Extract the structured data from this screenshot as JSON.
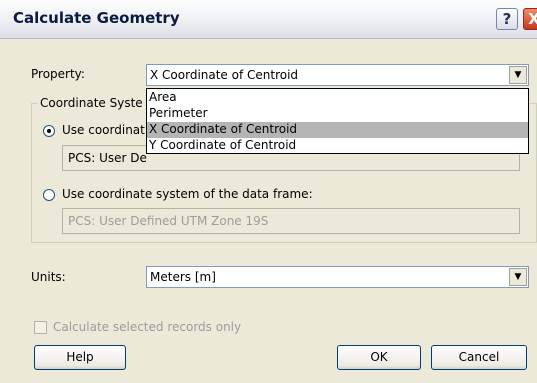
{
  "window": {
    "title": "Calculate Geometry",
    "help_glyph": "?",
    "close_glyph": "X"
  },
  "property": {
    "label": "Property:",
    "selected": "X Coordinate of Centroid",
    "options": [
      "Area",
      "Perimeter",
      "X Coordinate of Centroid",
      "Y Coordinate of Centroid"
    ],
    "highlighted_index": 2
  },
  "coordinate_system": {
    "group_label": "Coordinate Syste",
    "use_source": {
      "label": "Use coordinat",
      "checked": true,
      "value": "PCS: User De"
    },
    "use_frame": {
      "label": "Use coordinate system of the data frame:",
      "checked": false,
      "value": "PCS: User Defined UTM Zone 19S"
    }
  },
  "units": {
    "label": "Units:",
    "selected": "Meters [m]"
  },
  "selected_only": {
    "label": "Calculate selected records only",
    "checked": false,
    "enabled": false
  },
  "buttons": {
    "help": "Help",
    "ok": "OK",
    "cancel": "Cancel"
  },
  "icons": {
    "dropdown_arrow": "▼"
  }
}
